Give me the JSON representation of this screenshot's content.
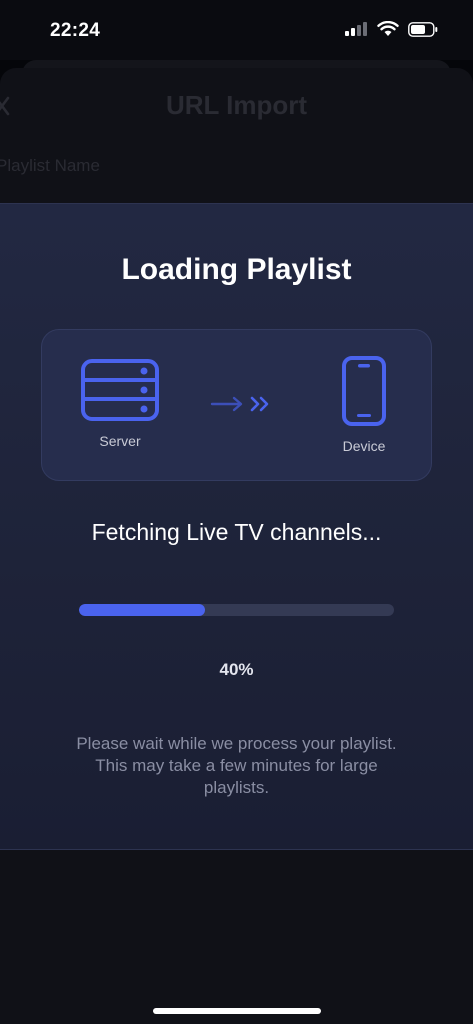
{
  "status_bar": {
    "time": "22:24",
    "icons": [
      "cellular-signal-icon",
      "wifi-icon",
      "battery-icon"
    ]
  },
  "background_sheet": {
    "title": "URL Import",
    "field_label": "Playlist Name",
    "close_icon": "close-icon"
  },
  "loading_modal": {
    "title": "Loading Playlist",
    "server_label": "Server",
    "device_label": "Device",
    "status_text": "Fetching Live TV channels...",
    "progress": 0.4,
    "progress_text": "40%",
    "note": "Please wait while we process your playlist. This may take a few minutes for large playlists."
  },
  "colors": {
    "accent": "#4a63ee",
    "modal_bg": "#20263f",
    "card_bg": "#262d4d",
    "track": "#343a54",
    "muted_text": "#8a8ea3"
  }
}
